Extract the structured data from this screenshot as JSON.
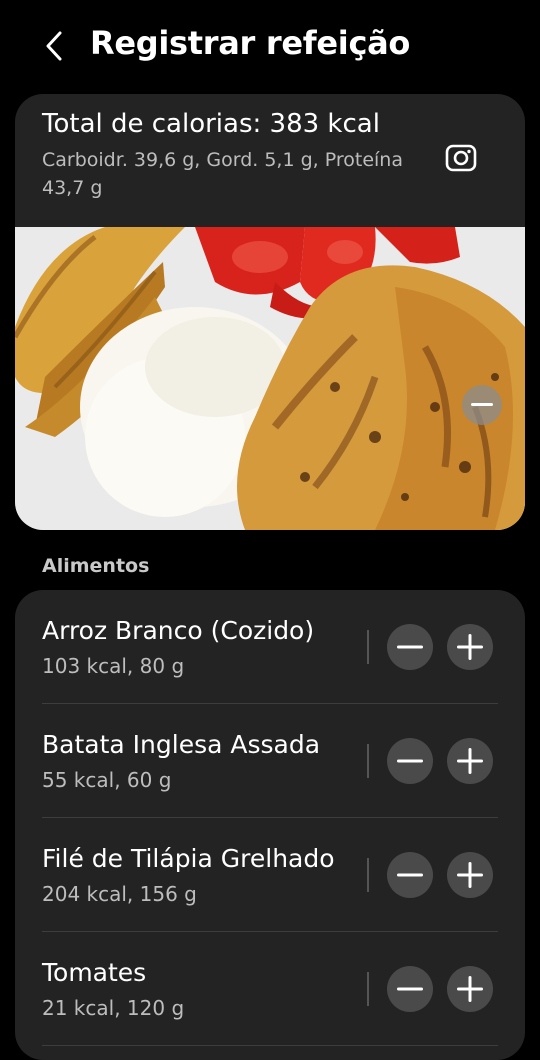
{
  "header": {
    "title": "Registrar refeição"
  },
  "summary": {
    "total_label": "Total de calorias: 383 kcal",
    "macros": "Carboidr. 39,6 g, Gord. 5,1 g, Proteína 43,7 g"
  },
  "section": {
    "foods_label": "Alimentos"
  },
  "foods": [
    {
      "name": "Arroz Branco (Cozido)",
      "meta": "103 kcal, 80 g"
    },
    {
      "name": "Batata Inglesa Assada",
      "meta": "55 kcal, 60 g"
    },
    {
      "name": "Filé de Tilápia Grelhado",
      "meta": "204 kcal, 156 g"
    },
    {
      "name": "Tomates",
      "meta": "21 kcal, 120 g"
    }
  ],
  "icons": {
    "back": "chevron-left-icon",
    "instagram": "instagram-icon",
    "remove_photo": "minus-icon",
    "decrease": "minus-icon",
    "increase": "plus-icon"
  },
  "colors": {
    "background": "#000000",
    "card": "#232323",
    "button": "#4a4a4a",
    "secondary_text": "#bdbdbd"
  }
}
